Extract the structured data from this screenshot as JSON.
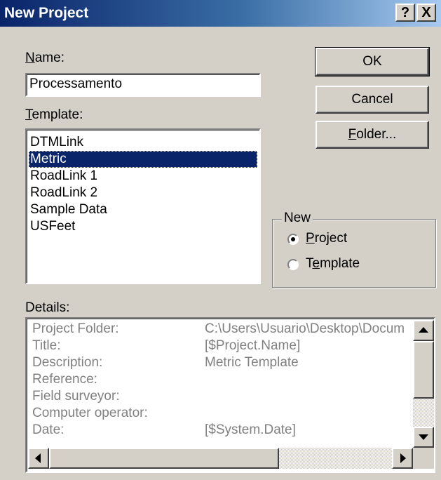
{
  "window": {
    "title": "New Project",
    "help_glyph": "?",
    "close_glyph": "X"
  },
  "name_section": {
    "label": "Name:",
    "value": "Processamento"
  },
  "template_section": {
    "label": "Template:",
    "items": [
      "DTMLink",
      "Metric",
      "RoadLink 1",
      "RoadLink 2",
      "Sample Data",
      "USFeet"
    ],
    "selected": "Metric"
  },
  "buttons": {
    "ok": "OK",
    "cancel": "Cancel",
    "folder": "Folder..."
  },
  "new_group": {
    "title": "New",
    "options": [
      "Project",
      "Template"
    ],
    "selected": "Project"
  },
  "details": {
    "label": "Details:",
    "rows": [
      {
        "label": "Project Folder:",
        "value": "C:\\Users\\Usuario\\Desktop\\Docum"
      },
      {
        "label": "Title:",
        "value": "[$Project.Name]"
      },
      {
        "label": "Description:",
        "value": "Metric Template"
      },
      {
        "label": "Reference:",
        "value": ""
      },
      {
        "label": "Field surveyor:",
        "value": ""
      },
      {
        "label": "Computer operator:",
        "value": ""
      },
      {
        "label": "Date:",
        "value": "[$System.Date]"
      }
    ]
  },
  "colors": {
    "title_gradient_start": "#0a246a",
    "title_gradient_end": "#a6caf0",
    "dialog_face": "#d4d0c8",
    "selection": "#0a246a",
    "disabled_text": "#808080"
  }
}
